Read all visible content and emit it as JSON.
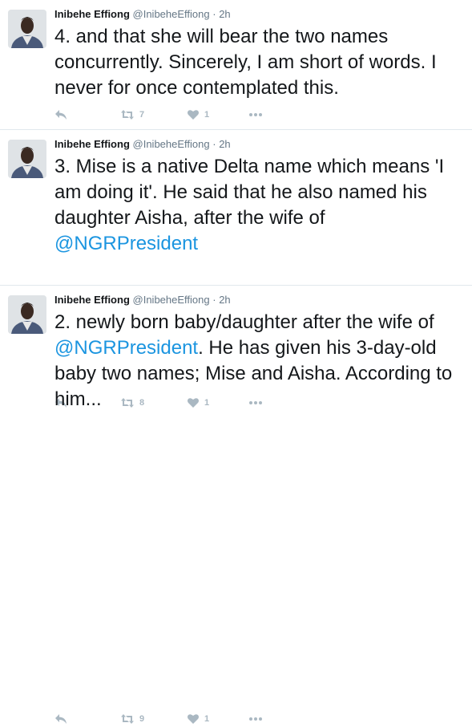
{
  "tweets": [
    {
      "name": "Inibehe Effiong",
      "handle": "@InibeheEffiong",
      "separator": "·",
      "time": "2h",
      "text_before": "4. and that she will bear the two names concurrently. Sincerely, I am short of words. I never for once contemplated this.",
      "mention": "",
      "text_after": "",
      "retweets": "7",
      "likes": "1"
    },
    {
      "name": "Inibehe Effiong",
      "handle": "@InibeheEffiong",
      "separator": "·",
      "time": "2h",
      "text_before": "3. Mise is a native Delta name which means 'I am doing it'. He said that he also named his daughter Aisha, after the wife of ",
      "mention": "@NGRPresident",
      "text_after": "",
      "retweets": "8",
      "likes": "1"
    },
    {
      "name": "Inibehe Effiong",
      "handle": "@InibeheEffiong",
      "separator": "·",
      "time": "2h",
      "text_before": "2. newly born baby/daughter after the wife of ",
      "mention": "@NGRPresident",
      "text_after": ". He has given his 3-day-old baby two names; Mise and Aisha. According to him...",
      "retweets": "9",
      "likes": "1"
    }
  ],
  "icons": {
    "reply": "reply-icon",
    "retweet": "retweet-icon",
    "like": "heart-icon",
    "more": "more-icon",
    "avatar": "profile-photo"
  },
  "colors": {
    "mention": "#1b95e0",
    "muted": "#657786",
    "action_icon": "#aab8c2",
    "divider": "#e1e8ed"
  }
}
